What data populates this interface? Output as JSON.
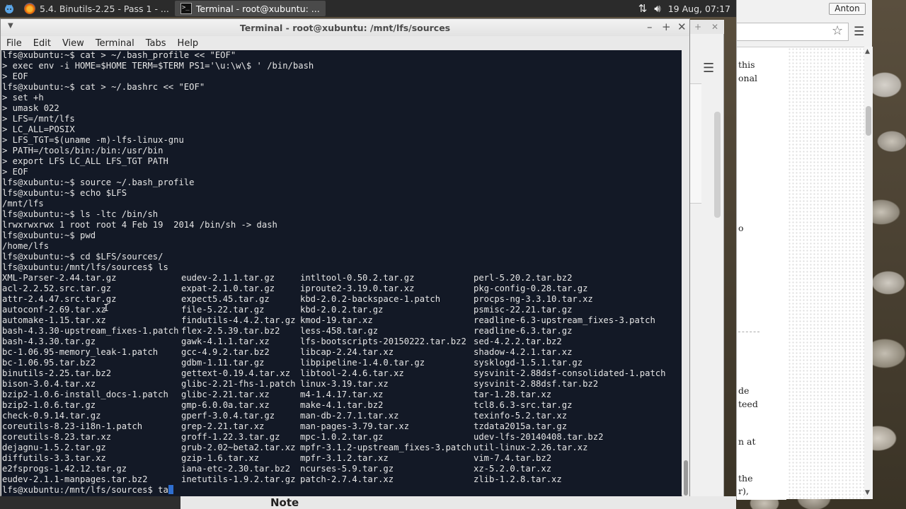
{
  "panel": {
    "tasks": [
      {
        "label": "5.4. Binutils-2.25 - Pass 1 - ...",
        "icon": "firefox-icon"
      },
      {
        "label": "Terminal - root@xubuntu: ...",
        "icon": "terminal-icon"
      }
    ],
    "clock": "19 Aug, 07:17"
  },
  "browser": {
    "user": "Anton",
    "fragments": [
      "this",
      "onal",
      "o",
      "de",
      "teed",
      "n at",
      "the",
      "r),"
    ]
  },
  "bottom": {
    "notes": "Note"
  },
  "terminal": {
    "title": "Terminal - root@xubuntu: /mnt/lfs/sources",
    "menu": [
      "File",
      "Edit",
      "View",
      "Terminal",
      "Tabs",
      "Help"
    ],
    "lines": [
      "lfs@xubuntu:~$ cat > ~/.bash_profile << \"EOF\"",
      "> exec env -i HOME=$HOME TERM=$TERM PS1='\\u:\\w\\$ ' /bin/bash",
      "> EOF",
      "lfs@xubuntu:~$ cat > ~/.bashrc << \"EOF\"",
      "> set +h",
      "> umask 022",
      "> LFS=/mnt/lfs",
      "> LC_ALL=POSIX",
      "> LFS_TGT=$(uname -m)-lfs-linux-gnu",
      "> PATH=/tools/bin:/bin:/usr/bin",
      "> export LFS LC_ALL LFS_TGT PATH",
      "> EOF",
      "lfs@xubuntu:~$ source ~/.bash_profile",
      "lfs@xubuntu:~$ echo $LFS",
      "/mnt/lfs",
      "lfs@xubuntu:~$ ls -ltc /bin/sh",
      "lrwxrwxrwx 1 root root 4 Feb 19  2014 /bin/sh -> dash",
      "lfs@xubuntu:~$ pwd",
      "/home/lfs",
      "lfs@xubuntu:~$ cd $LFS/sources/",
      "lfs@xubuntu:/mnt/lfs/sources$ ls"
    ],
    "ls_columns": [
      [
        "XML-Parser-2.44.tar.gz",
        "acl-2.2.52.src.tar.gz",
        "attr-2.4.47.src.tar.gz",
        "autoconf-2.69.tar.xz",
        "automake-1.15.tar.xz",
        "bash-4.3.30-upstream_fixes-1.patch",
        "bash-4.3.30.tar.gz",
        "bc-1.06.95-memory_leak-1.patch",
        "bc-1.06.95.tar.bz2",
        "binutils-2.25.tar.bz2",
        "bison-3.0.4.tar.xz",
        "bzip2-1.0.6-install_docs-1.patch",
        "bzip2-1.0.6.tar.gz",
        "check-0.9.14.tar.gz",
        "coreutils-8.23-i18n-1.patch",
        "coreutils-8.23.tar.xz",
        "dejagnu-1.5.2.tar.gz",
        "diffutils-3.3.tar.xz",
        "e2fsprogs-1.42.12.tar.gz",
        "eudev-2.1.1-manpages.tar.bz2"
      ],
      [
        "eudev-2.1.1.tar.gz",
        "expat-2.1.0.tar.gz",
        "expect5.45.tar.gz",
        "file-5.22.tar.gz",
        "findutils-4.4.2.tar.gz",
        "flex-2.5.39.tar.bz2",
        "gawk-4.1.1.tar.xz",
        "gcc-4.9.2.tar.bz2",
        "gdbm-1.11.tar.gz",
        "gettext-0.19.4.tar.xz",
        "glibc-2.21-fhs-1.patch",
        "glibc-2.21.tar.xz",
        "gmp-6.0.0a.tar.xz",
        "gperf-3.0.4.tar.gz",
        "grep-2.21.tar.xz",
        "groff-1.22.3.tar.gz",
        "grub-2.02~beta2.tar.xz",
        "gzip-1.6.tar.xz",
        "iana-etc-2.30.tar.bz2",
        "inetutils-1.9.2.tar.gz"
      ],
      [
        "intltool-0.50.2.tar.gz",
        "iproute2-3.19.0.tar.xz",
        "kbd-2.0.2-backspace-1.patch",
        "kbd-2.0.2.tar.gz",
        "kmod-19.tar.xz",
        "less-458.tar.gz",
        "lfs-bootscripts-20150222.tar.bz2",
        "libcap-2.24.tar.xz",
        "libpipeline-1.4.0.tar.gz",
        "libtool-2.4.6.tar.xz",
        "linux-3.19.tar.xz",
        "m4-1.4.17.tar.xz",
        "make-4.1.tar.bz2",
        "man-db-2.7.1.tar.xz",
        "man-pages-3.79.tar.xz",
        "mpc-1.0.2.tar.gz",
        "mpfr-3.1.2-upstream_fixes-3.patch",
        "mpfr-3.1.2.tar.xz",
        "ncurses-5.9.tar.gz",
        "patch-2.7.4.tar.xz"
      ],
      [
        "perl-5.20.2.tar.bz2",
        "pkg-config-0.28.tar.gz",
        "procps-ng-3.3.10.tar.xz",
        "psmisc-22.21.tar.gz",
        "readline-6.3-upstream_fixes-3.patch",
        "readline-6.3.tar.gz",
        "sed-4.2.2.tar.bz2",
        "shadow-4.2.1.tar.xz",
        "sysklogd-1.5.1.tar.gz",
        "sysvinit-2.88dsf-consolidated-1.patch",
        "sysvinit-2.88dsf.tar.bz2",
        "tar-1.28.tar.xz",
        "tcl8.6.3-src.tar.gz",
        "texinfo-5.2.tar.xz",
        "tzdata2015a.tar.gz",
        "udev-lfs-20140408.tar.bz2",
        "util-linux-2.26.tar.xz",
        "vim-7.4.tar.bz2",
        "xz-5.2.0.tar.xz",
        "zlib-1.2.8.tar.xz"
      ]
    ],
    "current_prompt": "lfs@xubuntu:/mnt/lfs/sources$ ",
    "current_input": "ta"
  }
}
